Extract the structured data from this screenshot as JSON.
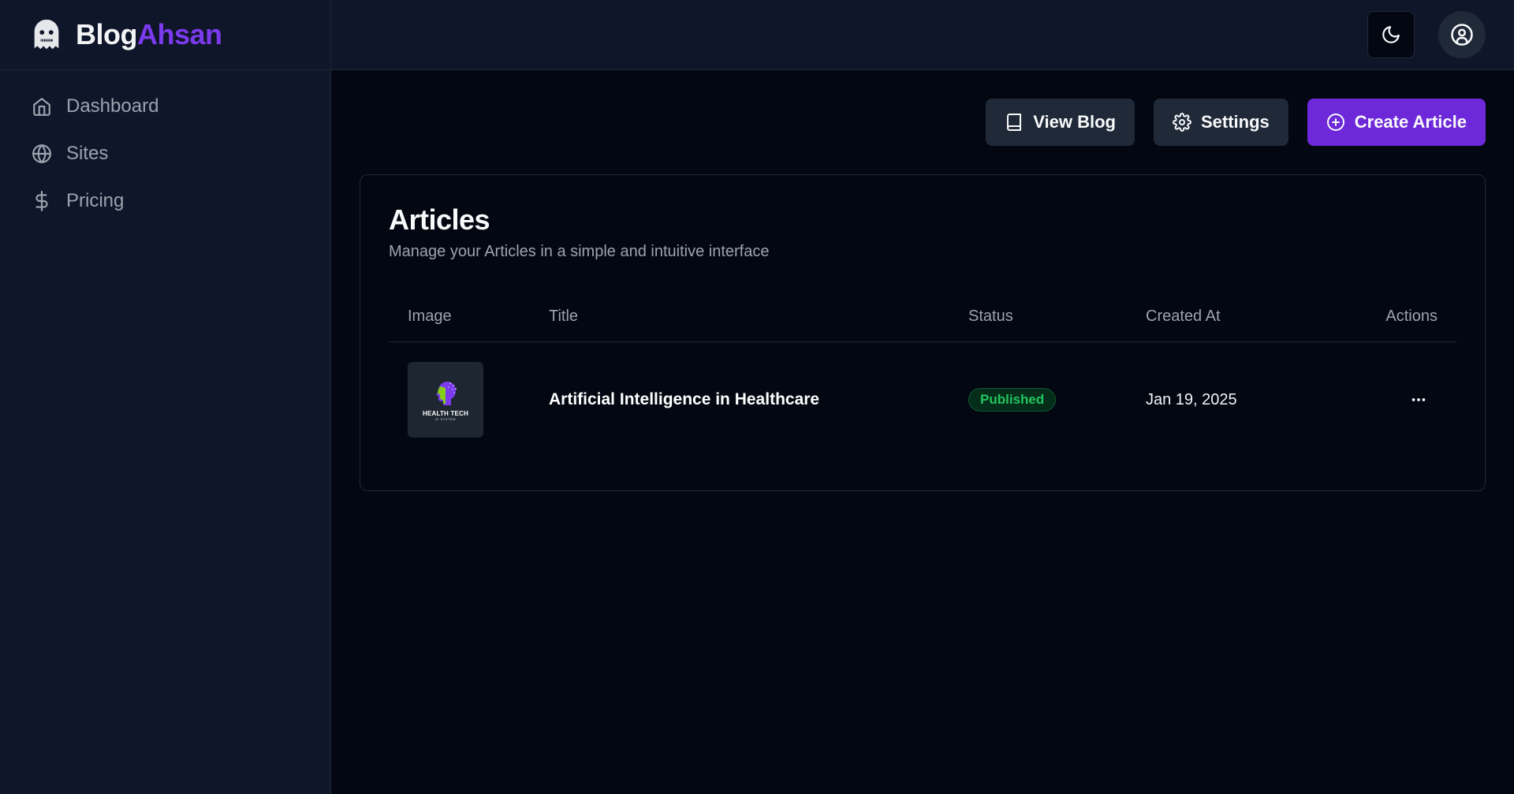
{
  "brand": {
    "part1": "Blog",
    "part2": "Ahsan"
  },
  "sidebar": {
    "items": [
      {
        "label": "Dashboard",
        "icon": "home-icon"
      },
      {
        "label": "Sites",
        "icon": "globe-icon"
      },
      {
        "label": "Pricing",
        "icon": "dollar-icon"
      }
    ]
  },
  "header": {
    "theme_icon": "moon-icon",
    "user_icon": "user-circle-icon"
  },
  "toolbar": {
    "view_blog": "View Blog",
    "settings": "Settings",
    "create_article": "Create Article"
  },
  "articles": {
    "title": "Articles",
    "description": "Manage your Articles in a simple and intuitive interface",
    "columns": [
      "Image",
      "Title",
      "Status",
      "Created At",
      "Actions"
    ],
    "rows": [
      {
        "image_text": "HEALTH TECH",
        "image_subtext": "AI SYSTEM",
        "title": "Artificial Intelligence in Healthcare",
        "status": "Published",
        "created_at": "Jan 19, 2025"
      }
    ]
  },
  "colors": {
    "accent": "#6d28d9",
    "brand_accent": "#7c3aed",
    "status_published": "#22c55e",
    "background": "#030712",
    "sidebar": "#0f1629"
  }
}
